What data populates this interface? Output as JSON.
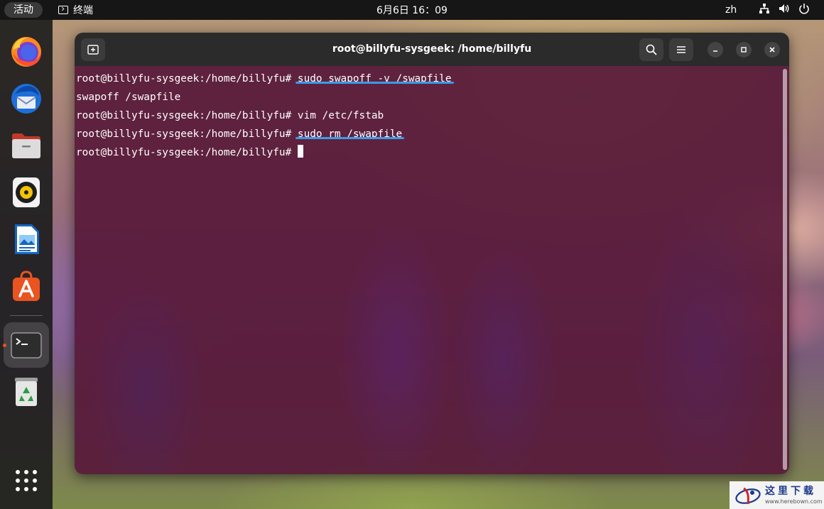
{
  "top_bar": {
    "activities_label": "活动",
    "app_name": "终端",
    "clock": "6月6日  16：09",
    "input_language": "zh"
  },
  "dock": {
    "items": [
      {
        "name": "Firefox",
        "icon": "firefox-icon"
      },
      {
        "name": "Thunderbird",
        "icon": "thunderbird-icon"
      },
      {
        "name": "Files",
        "icon": "files-icon"
      },
      {
        "name": "Rhythmbox",
        "icon": "rhythmbox-icon"
      },
      {
        "name": "LibreOffice Writer",
        "icon": "libreoffice-writer-icon"
      },
      {
        "name": "Ubuntu Software",
        "icon": "ubuntu-software-icon"
      },
      {
        "name": "Terminal",
        "icon": "terminal-icon",
        "active": true
      },
      {
        "name": "Trash",
        "icon": "trash-icon"
      }
    ],
    "show_apps_icon": "app-grid-icon"
  },
  "terminal": {
    "title": "root@billyfu-sysgeek: /home/billyfu",
    "lines": [
      {
        "prompt": "root@billyfu-sysgeek:/home/billyfu# ",
        "command": "sudo swapoff -v /swapfile",
        "highlighted": true
      },
      {
        "output": "swapoff /swapfile"
      },
      {
        "prompt": "root@billyfu-sysgeek:/home/billyfu# ",
        "command": "vim /etc/fstab",
        "highlighted": false
      },
      {
        "prompt": "root@billyfu-sysgeek:/home/billyfu# ",
        "command": "sudo rm /swapfile",
        "highlighted": true
      },
      {
        "prompt": "root@billyfu-sysgeek:/home/billyfu# ",
        "command": ""
      }
    ]
  },
  "watermark": {
    "site_name": "这里下载",
    "url": "www.herebown.com"
  },
  "colors": {
    "topbar": "#161616",
    "terminal_background": "#581a3a",
    "highlight_underline": "#3b9ae8",
    "ubuntu_orange": "#e95420"
  }
}
